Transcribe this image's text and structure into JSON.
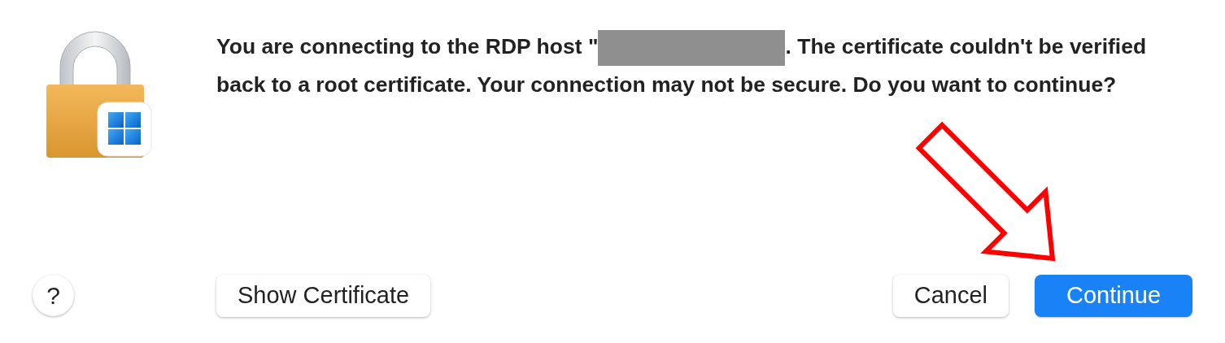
{
  "message": [
    {
      "kind": "text",
      "text": "You are connecting to the RDP host \""
    },
    {
      "kind": "redaction"
    },
    {
      "kind": "text",
      "text": ". The certificate couldn't be verified back to a root certificate. Your connection may not be secure. Do you want to continue?"
    }
  ],
  "help_button": {
    "label": "?"
  },
  "left_buttons": [
    {
      "label": "Show Certificate",
      "default": false
    }
  ],
  "right_buttons": [
    {
      "label": "Cancel",
      "default": false
    },
    {
      "label": "Continue",
      "default": true
    }
  ],
  "annotation": {
    "kind": "arrow"
  }
}
